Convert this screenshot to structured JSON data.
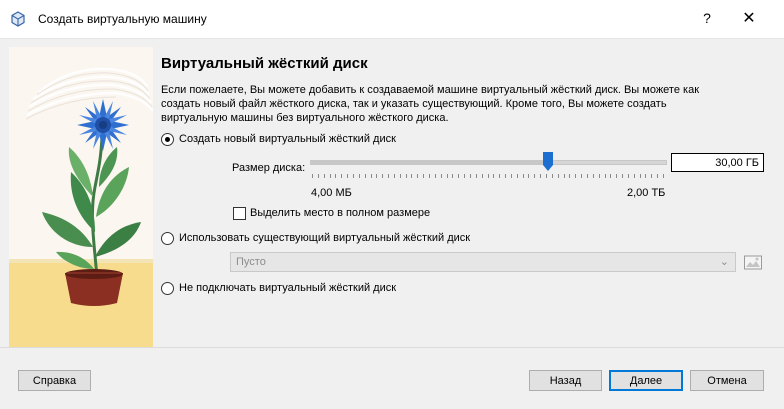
{
  "window": {
    "title": "Создать виртуальную машину",
    "help_label": "?",
    "close_label": "✕"
  },
  "page": {
    "heading": "Виртуальный жёсткий диск",
    "description": "Если пожелаете, Вы можете добавить к создаваемой машине виртуальный жёсткий диск. Вы можете как создать новый файл жёсткого диска, так и указать существующий. Кроме того, Вы можете создать виртуальную машины без виртуального жёсткого диска."
  },
  "options": {
    "create_new": {
      "label": "Создать новый виртуальный жёсткий диск",
      "checked": true
    },
    "use_existing": {
      "label": "Использовать существующий виртуальный жёсткий диск",
      "checked": false
    },
    "no_disk": {
      "label": "Не подключать виртуальный жёсткий диск",
      "checked": false
    }
  },
  "disk_size": {
    "label": "Размер диска:",
    "value": "30,00 ГБ",
    "min_label": "4,00 МБ",
    "max_label": "2,00 ТБ",
    "slider_fraction": 0.67
  },
  "preallocate": {
    "label": "Выделить место в полном размере",
    "checked": false
  },
  "existing_disk": {
    "value": "Пусто",
    "enabled": false
  },
  "buttons": {
    "help": "Справка",
    "back": "Назад",
    "next": "Далее",
    "cancel": "Отмена"
  },
  "colors": {
    "accent": "#0078d7",
    "slider_thumb": "#1c6fd1",
    "flower_blue": "#2f6fd0",
    "leaf_green": "#3f8a4a",
    "pot": "#8a2f22",
    "sand": "#f7dc8e"
  }
}
